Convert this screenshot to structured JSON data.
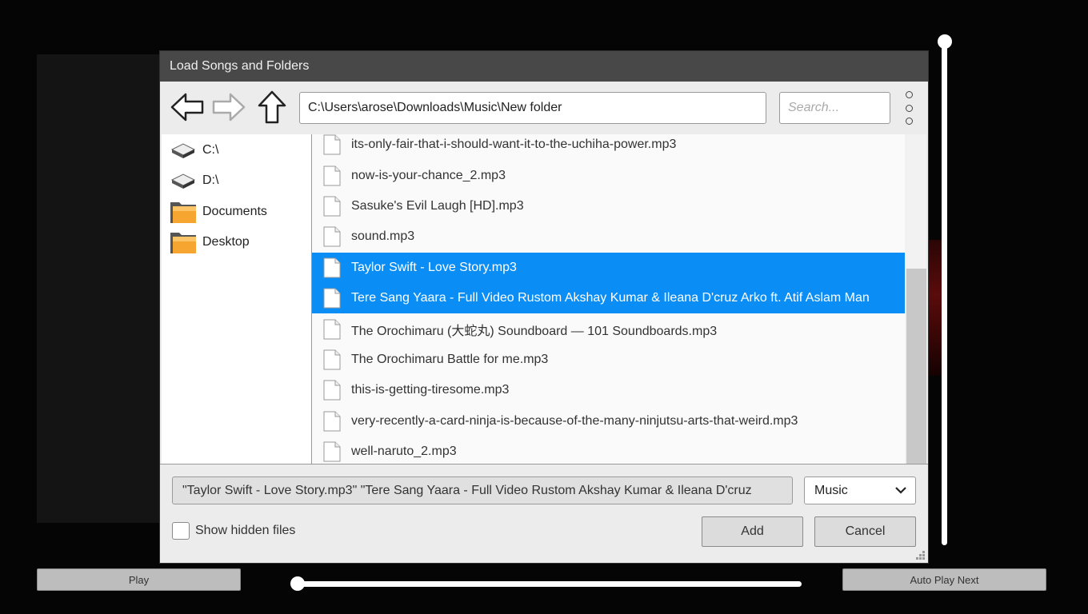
{
  "dialog": {
    "title": "Load Songs and Folders",
    "path": "C:\\Users\\arose\\Downloads\\Music\\New folder",
    "search_placeholder": "Search...",
    "sidebar": [
      {
        "label": "C:\\",
        "icon": "drive-icon"
      },
      {
        "label": "D:\\",
        "icon": "drive-icon"
      },
      {
        "label": "Documents",
        "icon": "folder-icon"
      },
      {
        "label": "Desktop",
        "icon": "folder-icon"
      }
    ],
    "files": [
      {
        "name": "its-only-fair-that-i-should-want-it-to-the-uchiha-power.mp3",
        "selected": false
      },
      {
        "name": "now-is-your-chance_2.mp3",
        "selected": false
      },
      {
        "name": "Sasuke's Evil Laugh [HD].mp3",
        "selected": false
      },
      {
        "name": "sound.mp3",
        "selected": false
      },
      {
        "name": "Taylor Swift - Love Story.mp3",
        "selected": true
      },
      {
        "name": "Tere Sang Yaara - Full Video  Rustom  Akshay Kumar & Ileana D'cruz  Arko ft. Atif Aslam  Man",
        "selected": true
      },
      {
        "name": "The Orochimaru (大蛇丸) Soundboard — 101 Soundboards.mp3",
        "selected": false
      },
      {
        "name": "The Orochimaru Battle for me.mp3",
        "selected": false
      },
      {
        "name": "this-is-getting-tiresome.mp3",
        "selected": false
      },
      {
        "name": "very-recently-a-card-ninja-is-because-of-the-many-ninjutsu-arts-that-weird.mp3",
        "selected": false
      },
      {
        "name": "well-naruto_2.mp3",
        "selected": false
      }
    ],
    "filename_value": "\"Taylor Swift - Love Story.mp3\" \"Tere Sang Yaara - Full Video  Rustom  Akshay Kumar & Ileana D'cruz",
    "file_type": "Music",
    "show_hidden_label": "Show hidden files",
    "show_hidden_checked": false,
    "add_label": "Add",
    "cancel_label": "Cancel"
  },
  "player": {
    "play_label": "Play",
    "auto_play_label": "Auto Play Next"
  },
  "colors": {
    "selection": "#0a8ef6",
    "titlebar": "#484848"
  }
}
